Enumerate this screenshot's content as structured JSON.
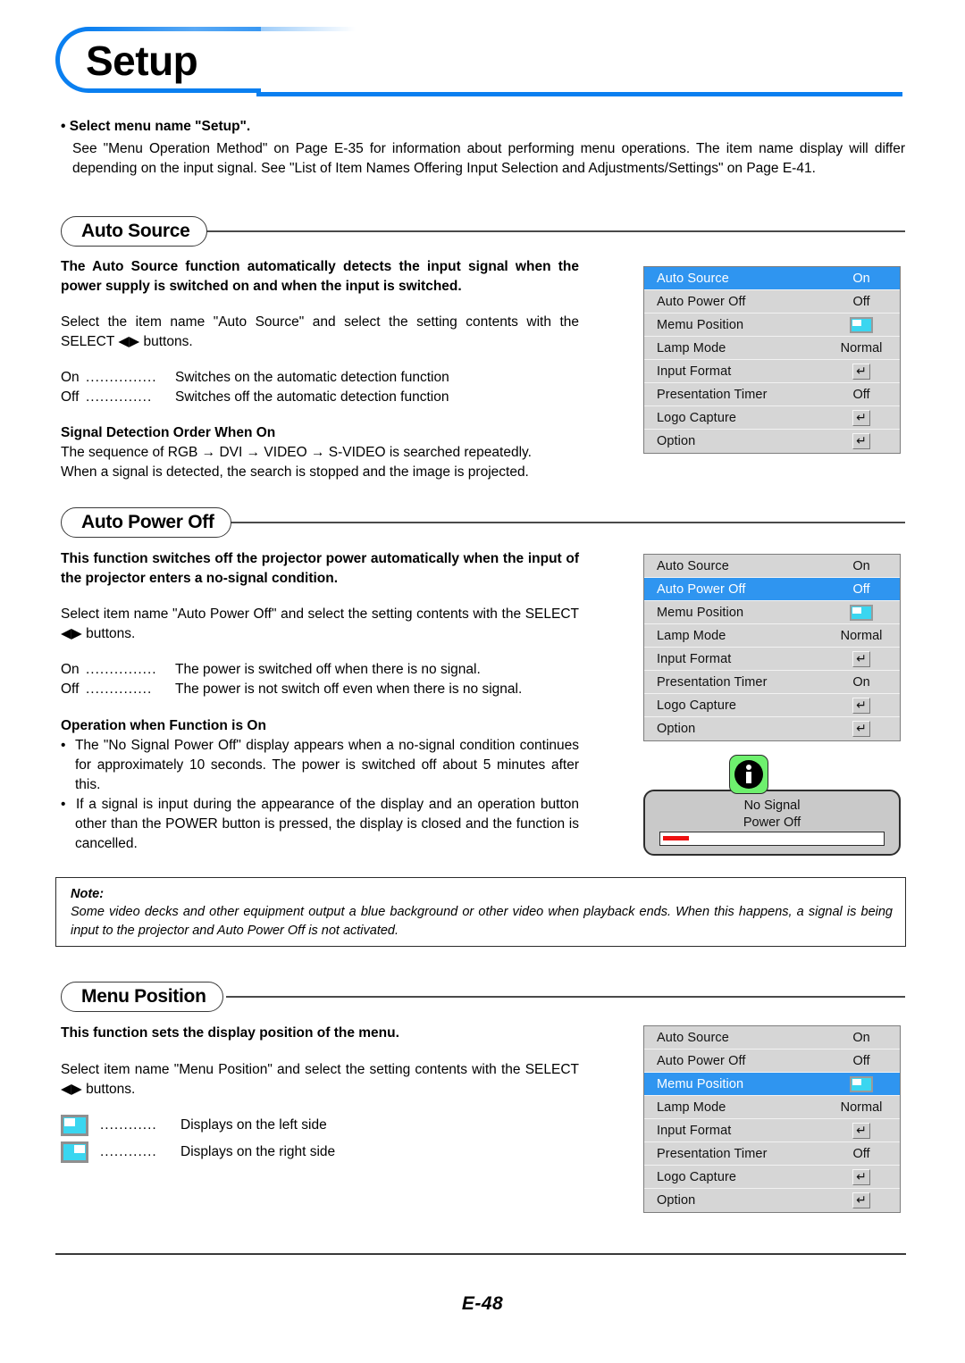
{
  "title": "Setup",
  "intro": {
    "heading": "• Select menu name \"Setup\".",
    "body": "See \"Menu Operation Method\" on Page E-35 for information about performing menu operations. The item name display will differ depending on the input signal. See \"List of Item Names Offering Input Selection and Adjustments/Settings\" on Page E-41."
  },
  "sections": {
    "auto_source": {
      "heading": "Auto Source",
      "intro_bold": "The Auto Source function automatically detects the input signal when the power supply is switched on and when the input is switched.",
      "instruction": "Select the item name \"Auto Source\" and select the setting contents with the SELECT ◀▶ buttons.",
      "options": [
        {
          "key": "On",
          "dots": "...............",
          "value": "Switches on the automatic detection function"
        },
        {
          "key": "Off",
          "dots": "..............",
          "value": "Switches off the automatic detection function"
        }
      ],
      "sub_heading": "Signal Detection Order When On",
      "sub_body_line1": "The sequence of RGB → DVI → VIDEO → S-VIDEO is searched repeatedly.",
      "sub_body_line2": "When a signal is detected, the search is stopped and the image is projected."
    },
    "auto_power_off": {
      "heading": "Auto Power Off",
      "intro_bold": "This function switches off the projector power automatically when the input of the projector enters a no-signal condition.",
      "instruction": "Select item name \"Auto Power Off\" and select the setting contents with the SELECT ◀▶ buttons.",
      "options": [
        {
          "key": "On",
          "dots": "...............",
          "value": "The power is switched off when there is no signal."
        },
        {
          "key": "Off",
          "dots": "..............",
          "value": "The power is not switch off even when there is no signal."
        }
      ],
      "sub_heading": "Operation when Function is On",
      "bullets": [
        "The \"No Signal Power Off\" display appears when a no-signal condition continues for approximately 10 seconds. The power is switched off about 5 minutes after this.",
        "If a signal is input during the appearance of the display and an operation button other than the POWER button is pressed, the display is closed and the function is cancelled."
      ]
    },
    "menu_position": {
      "heading": "Menu Position",
      "intro_bold": "This function sets the display position of the menu.",
      "instruction": "Select item name \"Menu Position\" and select the setting contents with the SELECT ◀▶ buttons.",
      "options": [
        {
          "icon": "menu-position-left-icon",
          "dots": "............",
          "value": "Displays on the left side"
        },
        {
          "icon": "menu-position-right-icon",
          "dots": "............",
          "value": "Displays on the right side"
        }
      ]
    }
  },
  "note": {
    "label": "Note:",
    "text": "Some video decks and other equipment output a blue background or other video when playback ends. When this happens, a signal is being input to the projector and Auto Power Off is not activated."
  },
  "no_signal_dialog": {
    "icon": "info-icon",
    "line1": "No Signal",
    "line2": "Power Off",
    "progress_percent": 12
  },
  "osd_menus": [
    {
      "id": "osd-auto-source",
      "selected_index": 0,
      "rows": [
        {
          "label": "Auto Source",
          "value": "On",
          "type": "text"
        },
        {
          "label": "Auto Power Off",
          "value": "Off",
          "type": "text"
        },
        {
          "label": "Memu Position",
          "value": "",
          "type": "position-left"
        },
        {
          "label": "Lamp Mode",
          "value": "Normal",
          "type": "text"
        },
        {
          "label": "Input Format",
          "value": "",
          "type": "enter"
        },
        {
          "label": "Presentation Timer",
          "value": "Off",
          "type": "text"
        },
        {
          "label": "Logo Capture",
          "value": "",
          "type": "enter"
        },
        {
          "label": "Option",
          "value": "",
          "type": "enter"
        }
      ]
    },
    {
      "id": "osd-auto-power-off",
      "selected_index": 1,
      "rows": [
        {
          "label": "Auto Source",
          "value": "On",
          "type": "text"
        },
        {
          "label": "Auto Power Off",
          "value": "Off",
          "type": "text"
        },
        {
          "label": "Memu Position",
          "value": "",
          "type": "position-left"
        },
        {
          "label": "Lamp Mode",
          "value": "Normal",
          "type": "text"
        },
        {
          "label": "Input Format",
          "value": "",
          "type": "enter"
        },
        {
          "label": "Presentation Timer",
          "value": "On",
          "type": "text"
        },
        {
          "label": "Logo Capture",
          "value": "",
          "type": "enter"
        },
        {
          "label": "Option",
          "value": "",
          "type": "enter"
        }
      ]
    },
    {
      "id": "osd-menu-position",
      "selected_index": 2,
      "rows": [
        {
          "label": "Auto Source",
          "value": "On",
          "type": "text"
        },
        {
          "label": "Auto Power Off",
          "value": "Off",
          "type": "text"
        },
        {
          "label": "Memu Position",
          "value": "",
          "type": "position-left"
        },
        {
          "label": "Lamp Mode",
          "value": "Normal",
          "type": "text"
        },
        {
          "label": "Input Format",
          "value": "",
          "type": "enter"
        },
        {
          "label": "Presentation Timer",
          "value": "Off",
          "type": "text"
        },
        {
          "label": "Logo Capture",
          "value": "",
          "type": "enter"
        },
        {
          "label": "Option",
          "value": "",
          "type": "enter"
        }
      ]
    }
  ],
  "footer": {
    "page": "E-48"
  },
  "colors": {
    "accent_blue": "#0a7ff0",
    "osd_highlight": "#2f95f0",
    "osd_bg": "#d6d6d6",
    "icon_cyan": "#3ad6f0",
    "info_green": "#6ef06e",
    "progress_red": "#ee1111"
  }
}
